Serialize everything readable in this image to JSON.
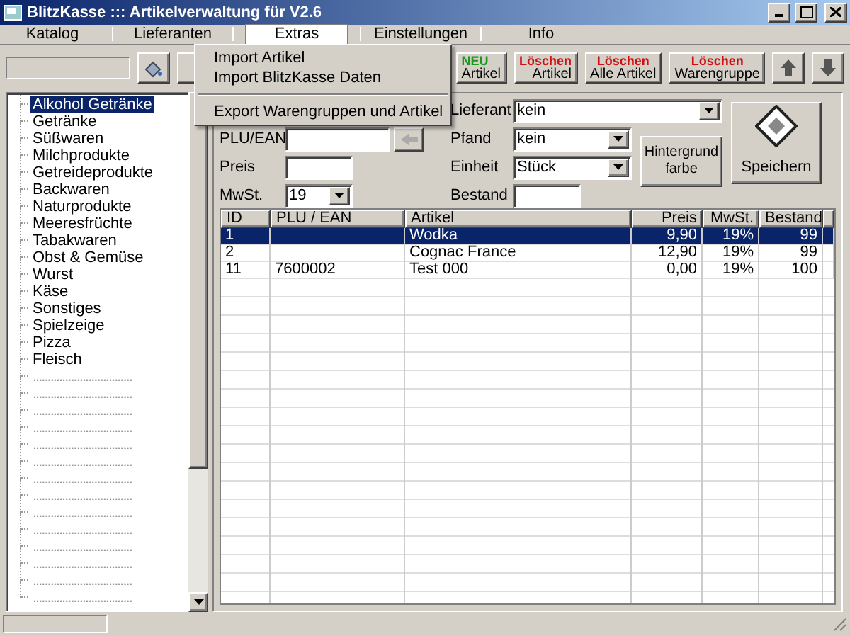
{
  "window": {
    "title": "BlitzKasse ::: Artikelverwaltung für V2.6"
  },
  "menu": [
    {
      "label": "Katalog",
      "selected": false
    },
    {
      "label": "Lieferanten",
      "selected": false
    },
    {
      "label": "Extras",
      "selected": true
    },
    {
      "label": "Einstellungen",
      "selected": false
    },
    {
      "label": "Info",
      "selected": false
    }
  ],
  "open_menu": {
    "groups": [
      [
        "Import Artikel",
        "Import BlitzKasse Daten"
      ],
      [
        "Export Warengruppen und Artikel"
      ]
    ]
  },
  "toolbar": {
    "buttons": [
      {
        "kind": "new",
        "top": "NEU",
        "bottom": "Artikel"
      },
      {
        "kind": "delete",
        "top": "Löschen",
        "bottom": "Artikel"
      },
      {
        "kind": "delete",
        "top": "Löschen",
        "bottom": "Alle Artikel"
      },
      {
        "kind": "delete",
        "top": "Löschen",
        "bottom": "Warengruppe"
      },
      {
        "kind": "up"
      },
      {
        "kind": "down"
      }
    ]
  },
  "tree": {
    "items": [
      {
        "label": "Alkohol Getränke",
        "selected": true
      },
      {
        "label": "Getränke",
        "selected": false
      },
      {
        "label": "Süßwaren",
        "selected": false
      },
      {
        "label": "Milchprodukte",
        "selected": false
      },
      {
        "label": "Getreideprodukte",
        "selected": false
      },
      {
        "label": "Backwaren",
        "selected": false
      },
      {
        "label": "Naturprodukte",
        "selected": false
      },
      {
        "label": "Meeresfrüchte",
        "selected": false
      },
      {
        "label": "Tabakwaren",
        "selected": false
      },
      {
        "label": "Obst & Gemüse",
        "selected": false
      },
      {
        "label": "Wurst",
        "selected": false
      },
      {
        "label": "Käse",
        "selected": false
      },
      {
        "label": "Sonstiges",
        "selected": false
      },
      {
        "label": "Spielzeige",
        "selected": false
      },
      {
        "label": "Pizza",
        "selected": false
      },
      {
        "label": "Fleisch",
        "selected": false
      },
      {
        "label": "..................................",
        "selected": false
      },
      {
        "label": "..................................",
        "selected": false
      },
      {
        "label": "..................................",
        "selected": false
      },
      {
        "label": "..................................",
        "selected": false
      },
      {
        "label": "..................................",
        "selected": false
      },
      {
        "label": "..................................",
        "selected": false
      },
      {
        "label": "..................................",
        "selected": false
      },
      {
        "label": "..................................",
        "selected": false
      },
      {
        "label": "..................................",
        "selected": false
      },
      {
        "label": "..................................",
        "selected": false
      },
      {
        "label": "..................................",
        "selected": false
      },
      {
        "label": "..................................",
        "selected": false
      },
      {
        "label": "..................................",
        "selected": false
      },
      {
        "label": "..................................",
        "selected": false
      }
    ]
  },
  "form": {
    "left": [
      {
        "label": "PLU/EAN",
        "kind": "input-arrow"
      },
      {
        "label": "Preis",
        "kind": "input"
      },
      {
        "label": "MwSt.",
        "kind": "select",
        "value": "19"
      }
    ],
    "middle": [
      {
        "label": "Lieferant",
        "kind": "select-wide",
        "value": "kein"
      },
      {
        "label": "Pfand",
        "kind": "select",
        "value": "kein"
      },
      {
        "label": "Einheit",
        "kind": "select",
        "value": "Stück"
      },
      {
        "label": "Bestand",
        "kind": "input"
      }
    ],
    "color_button": "Hintergrund farbe",
    "save_button": "Speichern"
  },
  "table": {
    "columns": [
      "ID",
      "PLU / EAN",
      "Artikel",
      "Preis",
      "MwSt.",
      "Bestand"
    ],
    "rows": [
      {
        "cells": [
          "1",
          "",
          "Wodka",
          "9,90",
          "19%",
          "99"
        ],
        "selected": true
      },
      {
        "cells": [
          "2",
          "",
          "Cognac France",
          "12,90",
          "19%",
          "99"
        ],
        "selected": false
      },
      {
        "cells": [
          "11",
          "7600002",
          "Test 000",
          "0,00",
          "19%",
          "100"
        ],
        "selected": false
      }
    ]
  }
}
